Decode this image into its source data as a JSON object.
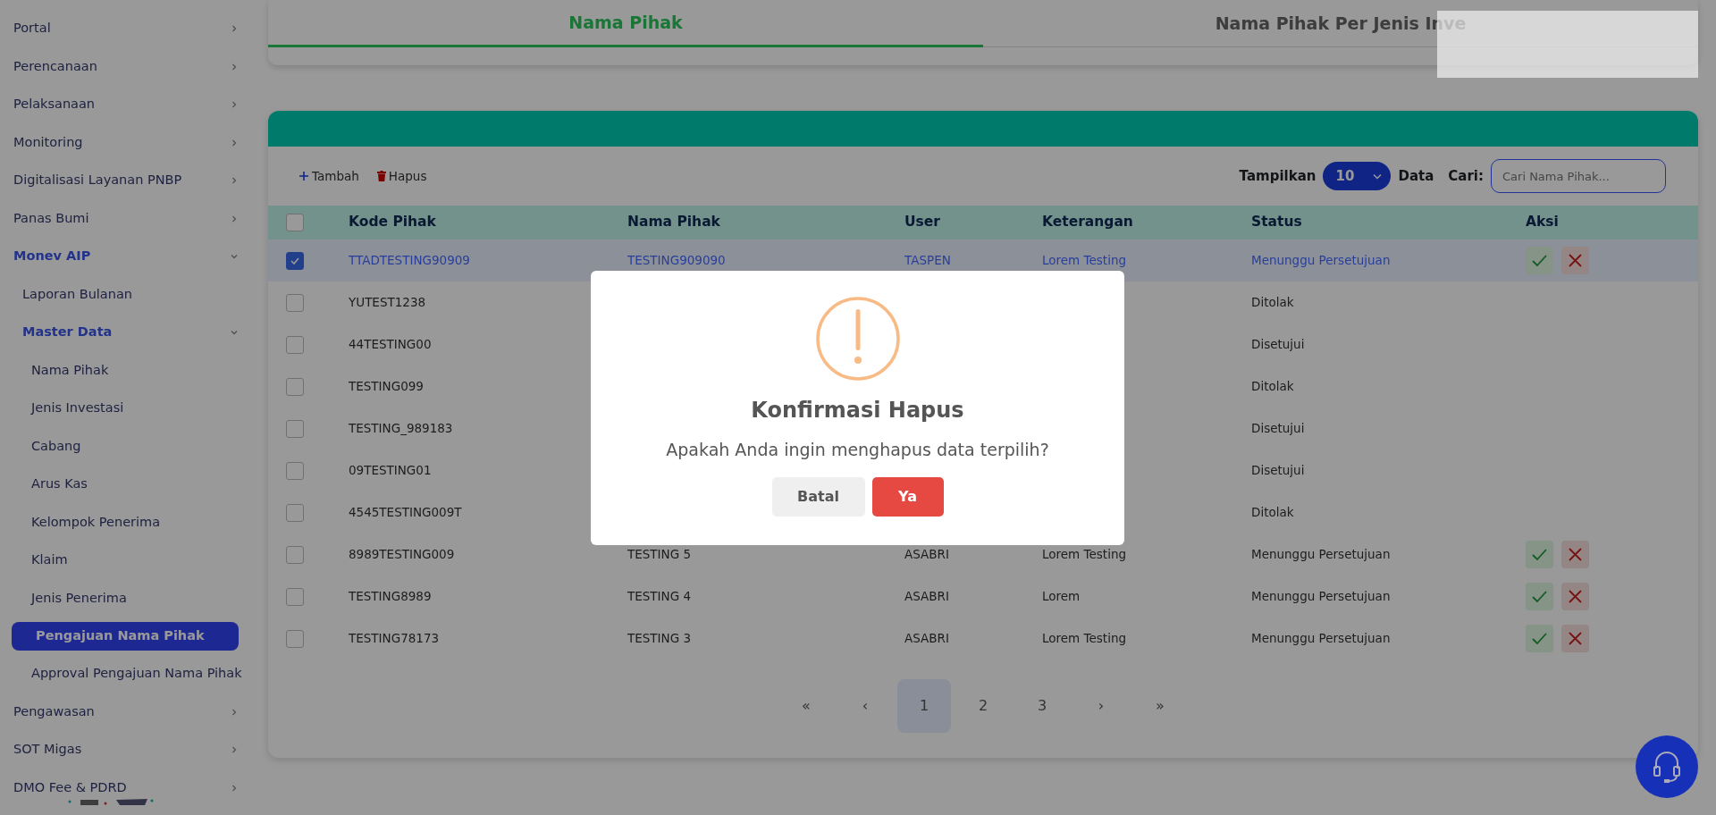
{
  "sidebar": {
    "items": [
      {
        "label": "Portal",
        "expanded": false
      },
      {
        "label": "Perencanaan",
        "expanded": false
      },
      {
        "label": "Pelaksanaan",
        "expanded": false
      },
      {
        "label": "Monitoring",
        "expanded": false
      },
      {
        "label": "Digitalisasi Layanan PNBP",
        "expanded": false
      },
      {
        "label": "Panas Bumi",
        "expanded": false
      },
      {
        "label": "Monev AIP",
        "expanded": true,
        "children": [
          {
            "label": "Laporan Bulanan",
            "selected": false
          },
          {
            "label": "Master Data",
            "expanded": true,
            "children": [
              {
                "label": "Nama Pihak",
                "selected": false
              },
              {
                "label": "Jenis Investasi",
                "selected": false
              },
              {
                "label": "Cabang",
                "selected": false
              },
              {
                "label": "Arus Kas",
                "selected": false
              },
              {
                "label": "Kelompok Penerima",
                "selected": false
              },
              {
                "label": "Klaim",
                "selected": false
              },
              {
                "label": "Jenis Penerima",
                "selected": false
              },
              {
                "label": "Pengajuan Nama Pihak",
                "selected": true
              },
              {
                "label": "Approval Pengajuan Nama Pihak",
                "selected": false
              }
            ]
          }
        ]
      },
      {
        "label": "Pengawasan",
        "expanded": false
      },
      {
        "label": "SOT Migas",
        "expanded": false
      },
      {
        "label": "DMO Fee & PDRD",
        "expanded": false
      }
    ]
  },
  "tabs": [
    {
      "label": "Nama Pihak",
      "selected": true
    },
    {
      "label": "Nama Pihak Per Jenis Inve",
      "selected": false
    }
  ],
  "toolbar": {
    "add": "Tambah",
    "delete": "Hapus",
    "show_label": "Tampilkan",
    "page_size": "10",
    "data_label": "Data",
    "search_label": "Cari:",
    "search": {
      "placeholder": "Cari Nama Pihak..."
    }
  },
  "table": {
    "columns": [
      "Kode Pihak",
      "Nama Pihak",
      "User",
      "Keterangan",
      "Status",
      "Aksi"
    ],
    "select_all": false,
    "rows": [
      {
        "selected": true,
        "code": "TTADTESTING90909",
        "name": "TESTING909090",
        "user": "TASPEN",
        "note": "Lorem Testing",
        "status": "Menunggu Persetujuan",
        "actions": true
      },
      {
        "selected": false,
        "code": "YUTEST1238",
        "status": "Ditolak",
        "actions": false
      },
      {
        "selected": false,
        "code": "44TESTING00",
        "status": "Disetujui",
        "actions": false
      },
      {
        "selected": false,
        "code": "TESTING099",
        "status": "Ditolak",
        "actions": false
      },
      {
        "selected": false,
        "code": "TESTING_989183",
        "status": "Disetujui",
        "actions": false
      },
      {
        "selected": false,
        "code": "09TESTING01",
        "status": "Disetujui",
        "actions": false
      },
      {
        "selected": false,
        "code": "4545TESTING009T",
        "status": "Ditolak",
        "actions": false
      },
      {
        "selected": false,
        "code": "8989TESTING009",
        "name": "TESTING 5",
        "user": "ASABRI",
        "note": "Lorem Testing",
        "status": "Menunggu Persetujuan",
        "actions": true
      },
      {
        "selected": false,
        "code": "TESTING8989",
        "name": "TESTING 4",
        "user": "ASABRI",
        "note": "Lorem",
        "status": "Menunggu Persetujuan",
        "actions": true
      },
      {
        "selected": false,
        "code": "TESTING78173",
        "name": "TESTING 3",
        "user": "ASABRI",
        "note": "Lorem Testing",
        "status": "Menunggu Persetujuan",
        "actions": true
      }
    ]
  },
  "pagination": [
    {
      "label": "«",
      "selected": false
    },
    {
      "label": "‹",
      "selected": false
    },
    {
      "label": "1",
      "selected": true
    },
    {
      "label": "2",
      "selected": false
    },
    {
      "label": "3",
      "selected": false
    },
    {
      "label": "›",
      "selected": false
    },
    {
      "label": "»",
      "selected": false
    }
  ],
  "modal": {
    "title": "Konfirmasi Hapus",
    "message": "Apakah Anda ingin menghapus data terpilih?",
    "buttons": [
      {
        "label": "Batal",
        "kind": "cancel"
      },
      {
        "label": "Ya",
        "kind": "confirm"
      }
    ]
  }
}
